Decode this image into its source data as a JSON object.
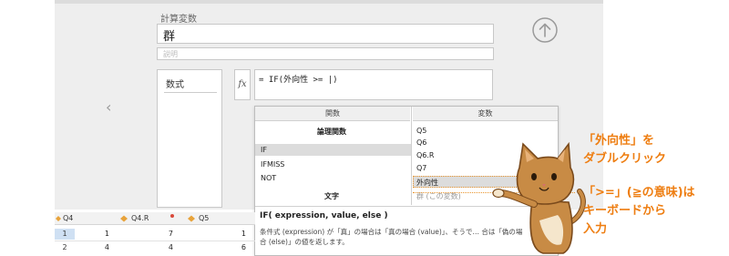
{
  "form": {
    "section_label": "計算変数",
    "name_value": "群",
    "description_placeholder": "説明",
    "formula_label": "数式",
    "expression": "= IF(外向性 >= |)"
  },
  "icons": {
    "fx": "fx-icon",
    "fx_text": "fx",
    "up_arrow": "arrow-up-circle-icon",
    "nav_left": "chevron-left-icon",
    "nav_left_glyph": "‹"
  },
  "popup": {
    "functions_header": "関数",
    "variables_header": "変数",
    "logic_category": "論理関数",
    "functions": [
      "IF",
      "IFMISS",
      "NOT"
    ],
    "text_category": "文字",
    "variables": [
      "Q5",
      "Q6",
      "Q6.R",
      "Q7",
      "外向性"
    ],
    "current_variable": "群 (この変数)",
    "help_title": "IF( expression, value, else )",
    "help_body": "条件式 (expression) が「真」の場合は「真の場合 (value)」、そうで… 合は「偽の場合 (else)」の値を返します。"
  },
  "sheet": {
    "columns": [
      "Q4",
      "Q4.R",
      "Q5"
    ],
    "rows": [
      {
        "num": "1",
        "q4": "1",
        "q4r": "7",
        "q5": "1"
      },
      {
        "num": "2",
        "q4": "4",
        "q4r": "4",
        "q5": "6"
      }
    ]
  },
  "annotations": {
    "note1_line1": "「外向性」を",
    "note1_line2": "ダブルクリック",
    "note2_line1": "「>=」(≧の意味)は",
    "note2_line2": "キーボードから",
    "note2_line3": "入力"
  },
  "colors": {
    "accent_orange": "#ee7d10",
    "selection": "#dcdcdc",
    "panel_bg": "#eeeeee",
    "variable_marker": "#e8a33b"
  }
}
